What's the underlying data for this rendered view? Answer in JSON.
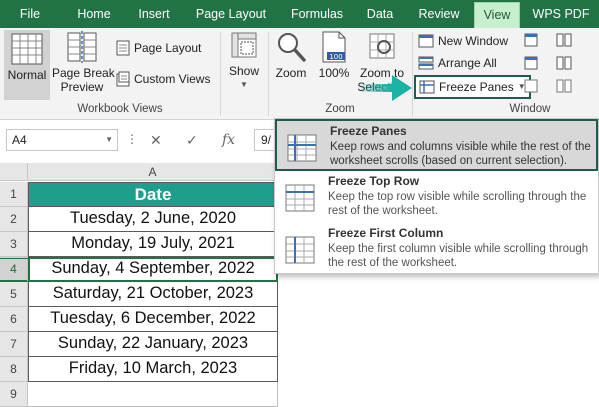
{
  "menu": {
    "tabs": [
      {
        "label": "File"
      },
      {
        "label": "Home"
      },
      {
        "label": "Insert"
      },
      {
        "label": "Page Layout"
      },
      {
        "label": "Formulas"
      },
      {
        "label": "Data"
      },
      {
        "label": "Review"
      },
      {
        "label": "View"
      },
      {
        "label": "WPS PDF"
      }
    ],
    "active_tab": "View"
  },
  "ribbon": {
    "workbook_views": {
      "label": "Workbook Views",
      "normal": "Normal",
      "page_break_line1": "Page Break",
      "page_break_line2": "Preview",
      "page_layout": "Page Layout",
      "custom_views": "Custom Views"
    },
    "show": {
      "label": "Show"
    },
    "zoom": {
      "label": "Zoom",
      "zoom": "Zoom",
      "hundred": "100%",
      "hundred_badge": "100",
      "zoom_to_line1": "Zoom to",
      "zoom_to_line2": "Selection"
    },
    "window": {
      "label": "Window",
      "new_window": "New Window",
      "arrange_all": "Arrange All",
      "freeze_panes": "Freeze Panes"
    }
  },
  "formula_bar": {
    "name_box": "A4",
    "fx": "fx",
    "value": "9/"
  },
  "sheet": {
    "column_header": "A",
    "rows": [
      {
        "num": "1",
        "value": "Date"
      },
      {
        "num": "2",
        "value": "Tuesday, 2 June, 2020"
      },
      {
        "num": "3",
        "value": "Monday, 19 July, 2021"
      },
      {
        "num": "4",
        "value": "Sunday, 4 September, 2022"
      },
      {
        "num": "5",
        "value": "Saturday, 21 October, 2023"
      },
      {
        "num": "6",
        "value": "Tuesday, 6 December, 2022"
      },
      {
        "num": "7",
        "value": "Sunday, 22 January, 2023"
      },
      {
        "num": "8",
        "value": "Friday, 10 March, 2023"
      },
      {
        "num": "9",
        "value": ""
      }
    ],
    "selected_row": "4",
    "header_color": "#1e9f8e"
  },
  "dropdown": {
    "items": [
      {
        "title": "Freeze Panes",
        "desc": "Keep rows and columns visible while the rest of the worksheet scrolls (based on current selection)."
      },
      {
        "title": "Freeze Top Row",
        "desc": "Keep the top row visible while scrolling through the rest of the worksheet."
      },
      {
        "title": "Freeze First Column",
        "desc": "Keep the first column visible while scrolling through the rest of the worksheet."
      }
    ]
  },
  "colors": {
    "excel_green": "#217346",
    "highlight_border": "#1e5c50",
    "arrow": "#1bb3a3"
  }
}
